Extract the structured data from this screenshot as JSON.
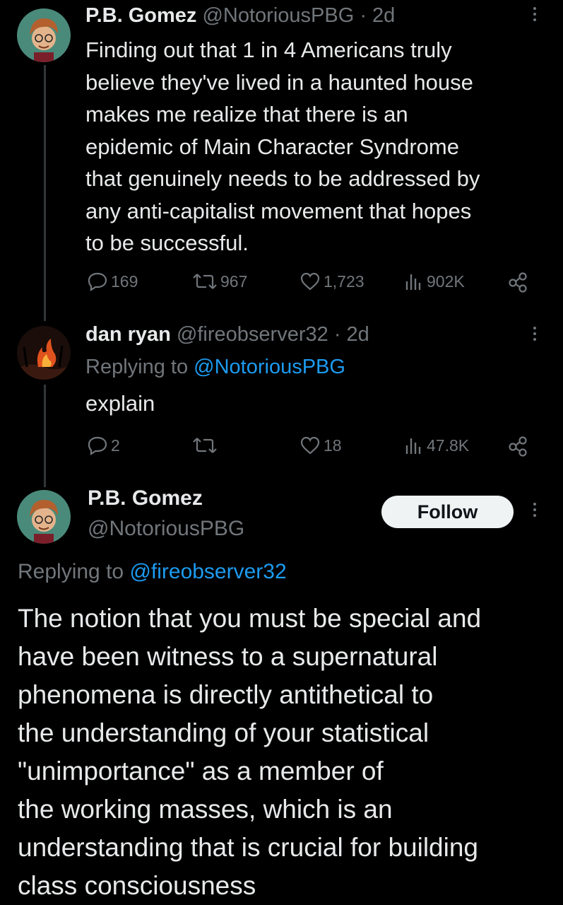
{
  "tweet1": {
    "name": "P.B. Gomez",
    "handle": "@NotoriousPBG",
    "time": "· 2d",
    "text": "Finding out that 1 in 4 Americans truly believe they've lived in a haunted house makes me realize that there is an epidemic of Main Character Syndrome that genuinely needs to be addressed by any anti-capitalist movement that hopes to be successful.",
    "lines": [
      "Finding out that 1 in 4 Americans truly",
      "believe they've lived in a haunted house",
      "makes me realize that there is an",
      "epidemic of Main Character Syndrome",
      "that genuinely needs to be addressed by",
      "any anti-capitalist movement that hopes",
      "to be successful."
    ],
    "replies": "169",
    "retweets": "967",
    "likes": "1,723",
    "views": "902K"
  },
  "tweet2": {
    "name": "dan ryan",
    "handle": "@fireobserver32",
    "time": "· 2d",
    "replying_prefix": "Replying to",
    "replying_handle": "@NotoriousPBG",
    "text": "explain",
    "replies": "2",
    "retweets": "",
    "likes": "18",
    "views": "47.8K"
  },
  "main": {
    "name": "P.B. Gomez",
    "handle": "@NotoriousPBG",
    "follow_label": "Follow",
    "replying_prefix": "Replying to",
    "replying_handle": "@fireobserver32",
    "lines": [
      "The notion that you must be special and",
      "have been witness to a supernatural",
      "phenomena is directly antithetical to",
      "the understanding of your statistical",
      "\"unimportance\" as a member of",
      "the working masses, which is an",
      "understanding that is crucial for building",
      "class consciousness"
    ]
  },
  "icons": {
    "reply": "reply-icon",
    "retweet": "retweet-icon",
    "like": "heart-icon",
    "views": "views-icon",
    "share": "share-icon",
    "more": "more-icon"
  },
  "colors": {
    "background": "#000000",
    "text": "#e7e9ea",
    "muted": "#71767b",
    "link": "#1d9bf0",
    "follow_bg": "#eff3f4"
  }
}
